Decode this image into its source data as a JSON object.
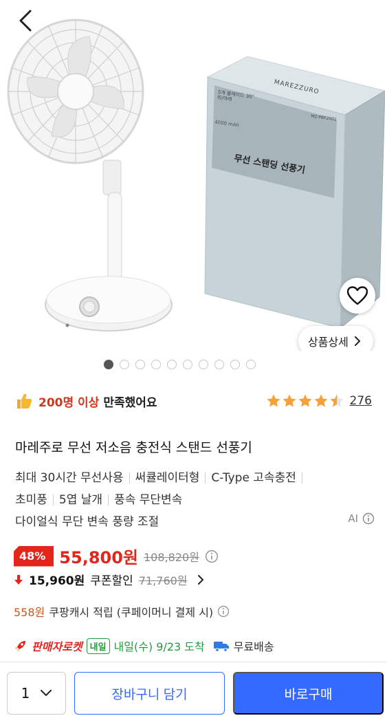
{
  "product": {
    "box_brand": "MAREZZURO",
    "box_spec": "5개 블레이드 30° 위/아래",
    "box_battery": "4000 mAh",
    "box_model": "MZ-PBF2001",
    "box_label": "무선 스탠딩 선풍기",
    "detail_button_label": "상품상세",
    "carousel_total": 10,
    "carousel_active_index": 0
  },
  "satisfaction": {
    "count_text": "200명 이상",
    "rest_text": "만족했어요"
  },
  "rating": {
    "stars": 4.5,
    "review_count": "276"
  },
  "title": "마레주로 무선 저소음 충전식 스탠드 선풍기",
  "features": {
    "row1": [
      "최대 30시간 무선사용",
      "써큘레이터형",
      "C-Type 고속충전"
    ],
    "row2": [
      "초미풍",
      "5엽 날개",
      "풍속 무단변속"
    ],
    "row3": "다이얼식 무단 변속 풍량 조절"
  },
  "ai_label": "AI",
  "price": {
    "discount": "48%",
    "sale": "55,800원",
    "original": "108,820원",
    "coupon_price": "15,960원",
    "coupon_text": "쿠폰할인",
    "coupon_original": "71,760원"
  },
  "cash": {
    "amount": "558원",
    "text": "쿠팡캐시 적립 (쿠페이머니 결제 시)"
  },
  "shipping": {
    "seller": "판매자로켓",
    "badge": "내일",
    "arrival": "내일(수) 9/23 도착",
    "free": "무료배송"
  },
  "bottom": {
    "quantity": "1",
    "cart_label": "장바구니 담기",
    "buy_label": "바로구매"
  },
  "colors": {
    "accent_blue": "#346aff",
    "sale_red": "#e2261b",
    "rocket_green": "#1f9d3f",
    "star_orange": "#f3a23a"
  }
}
